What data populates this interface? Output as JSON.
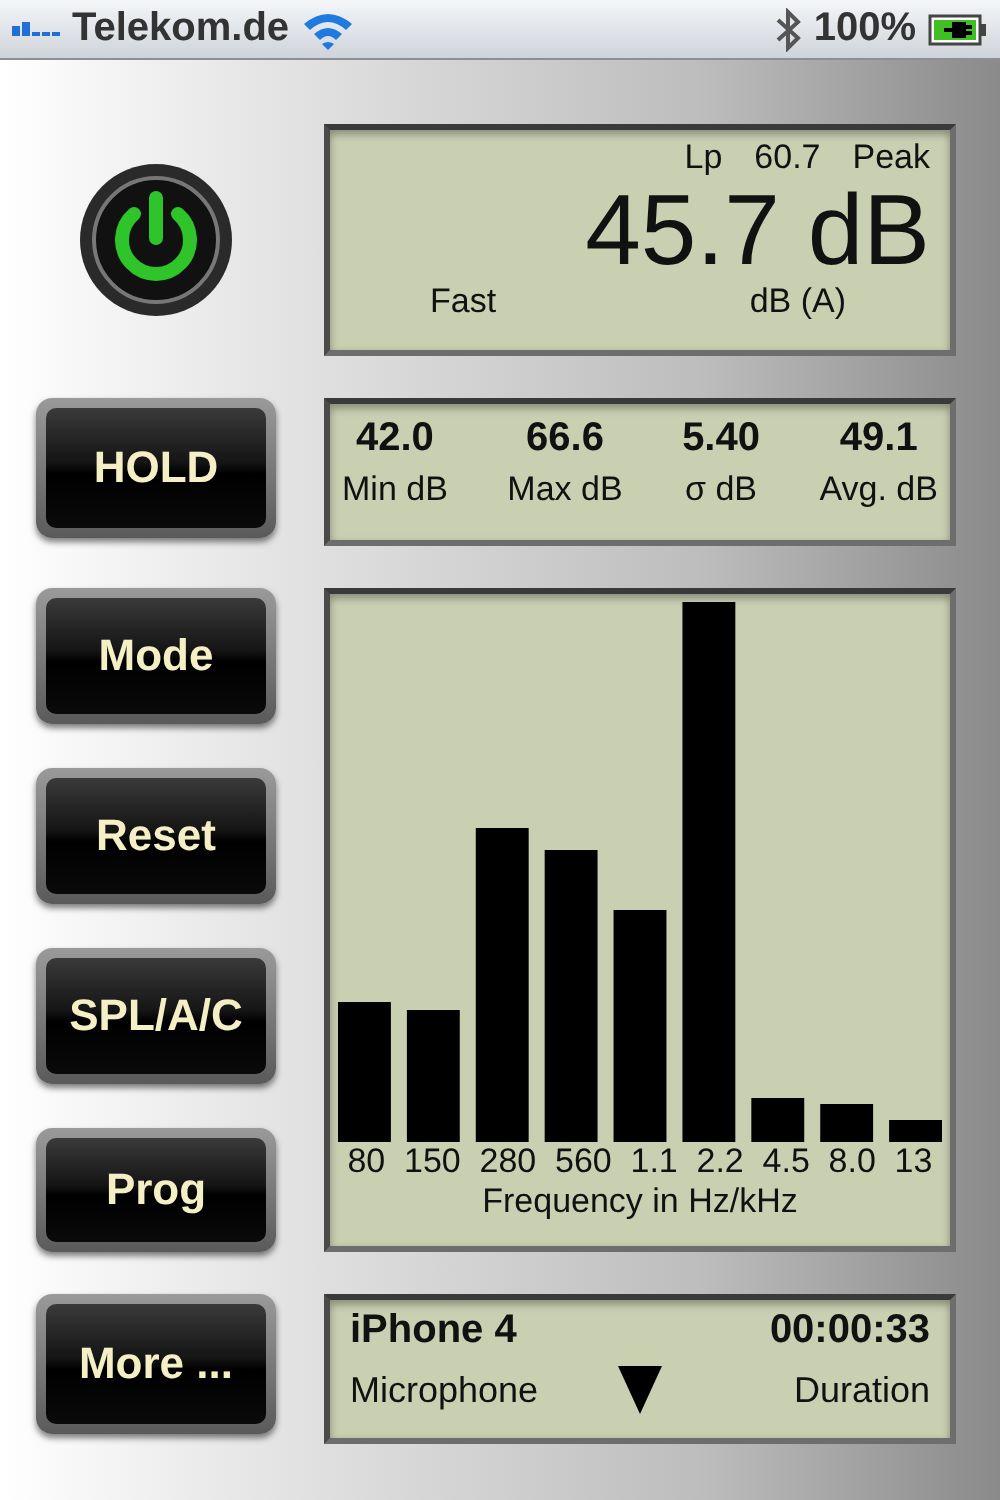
{
  "status_bar": {
    "carrier": "Telekom.de",
    "battery": "100%",
    "charging": true
  },
  "power": {
    "on": true
  },
  "main_display": {
    "mode_label": "Lp",
    "peak_value": "60.7",
    "peak_label": "Peak",
    "level": "45.7 dB",
    "time_weighting": "Fast",
    "weighting": "dB (A)"
  },
  "stats": [
    {
      "value": "42.0",
      "label": "Min dB"
    },
    {
      "value": "66.6",
      "label": "Max dB"
    },
    {
      "value": "5.40",
      "label": "σ dB"
    },
    {
      "value": "49.1",
      "label": "Avg. dB"
    }
  ],
  "buttons": [
    "HOLD",
    "Mode",
    "Reset",
    "SPL/A/C",
    "Prog",
    "More ..."
  ],
  "spectrum": {
    "band_labels": [
      "80",
      "150",
      "280",
      "560",
      "1.1",
      "2.2",
      "4.5",
      "8.0",
      "13"
    ],
    "axis_label": "Frequency in Hz/kHz"
  },
  "device": {
    "name": "iPhone 4",
    "source": "Microphone",
    "elapsed": "00:00:33",
    "elapsed_label": "Duration"
  }
}
